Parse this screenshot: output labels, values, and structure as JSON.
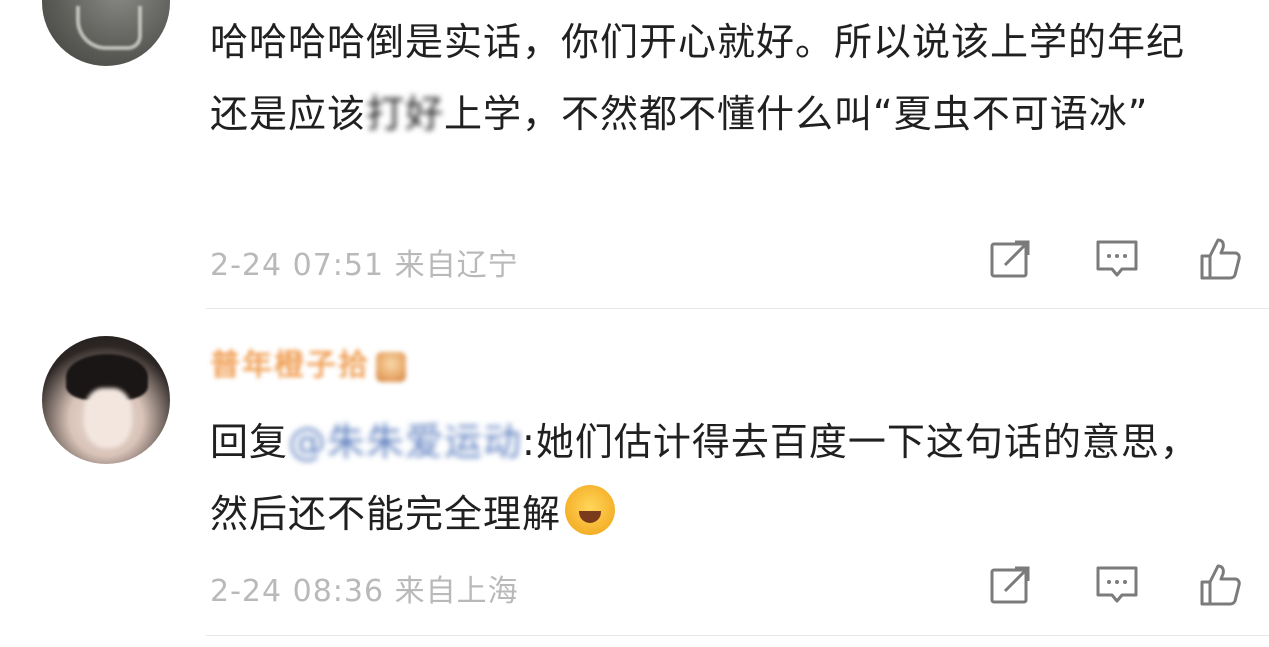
{
  "comments": [
    {
      "text_parts": {
        "a": "哈哈哈哈倒是实话，你们开心就好。所以说该上学的年纪还是应该",
        "blurred": "打好",
        "b": "上学，不然都不懂什么叫“夏虫不可语冰”"
      },
      "time": "2-24 07:51",
      "location": "来自辽宁",
      "icons": {
        "share": "share-icon",
        "reply": "comment-icon",
        "like": "thumbs-up-icon"
      }
    },
    {
      "username": "普年橙子拾",
      "text_parts": {
        "prefix": "回复",
        "mention": "@朱朱爱运动",
        "a": ":她们估计得去百度一下这句话的意思，然后还不能完全理解"
      },
      "time": "2-24 08:36",
      "location": "来自上海",
      "icons": {
        "share": "share-icon",
        "reply": "comment-icon",
        "like": "thumbs-up-icon",
        "emoji": "laughing-crying-emoji"
      }
    }
  ],
  "colors": {
    "text": "#202020",
    "meta": "#b9b9b9",
    "icon": "#7b7b7b",
    "divider": "#e9e9e9",
    "username": "#f0a057",
    "mention": "#5d7fbf"
  }
}
